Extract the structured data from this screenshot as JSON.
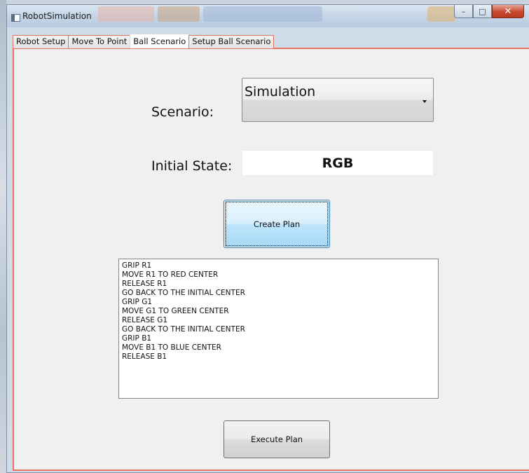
{
  "window": {
    "title": "RobotSimulation",
    "controls": {
      "minimize": "–",
      "maximize": "□",
      "close": "✕"
    }
  },
  "tabs": [
    {
      "label": "Robot Setup",
      "active": false
    },
    {
      "label": "Move To Point",
      "active": false
    },
    {
      "label": "Ball Scenario",
      "active": true
    },
    {
      "label": "Setup Ball Scenario",
      "active": false
    }
  ],
  "form": {
    "scenario_label": "Scenario:",
    "scenario_value": "Simulation",
    "initial_state_label": "Initial State:",
    "initial_state_value": "RGB"
  },
  "buttons": {
    "create_plan": "Create Plan",
    "execute_plan": "Execute Plan"
  },
  "plan_steps": [
    "GRIP R1",
    "MOVE R1 TO RED CENTER",
    "RELEASE R1",
    "GO BACK TO THE INITIAL CENTER",
    "GRIP G1",
    "MOVE G1 TO GREEN CENTER",
    "RELEASE G1",
    "GO BACK TO THE INITIAL CENTER",
    "GRIP B1",
    "MOVE B1 TO BLUE CENTER",
    "RELEASE B1"
  ],
  "colors": {
    "tab_border": "#e8735f",
    "focus_blue": "#3c7fb1",
    "close_red": "#c7482f"
  }
}
